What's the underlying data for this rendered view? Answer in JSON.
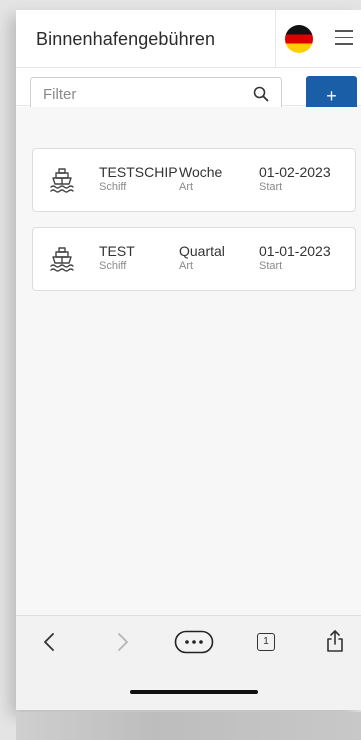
{
  "header": {
    "title": "Binnenhafengebühren"
  },
  "toolbar": {
    "filter_placeholder": "Filter",
    "add_label": "+"
  },
  "entries": [
    {
      "ship": "TESTSCHIP",
      "ship_label": "Schiff",
      "type": "Woche",
      "type_label": "Art",
      "start": "01-02-2023",
      "start_label": "Start"
    },
    {
      "ship": "TEST",
      "ship_label": "Schiff",
      "type": "Quartal",
      "type_label": "Art",
      "start": "01-01-2023",
      "start_label": "Start"
    }
  ],
  "browser": {
    "tabs_count": "1"
  },
  "colors": {
    "accent": "#1a5ea8",
    "flag": [
      "#111111",
      "#dd0000",
      "#ffce00"
    ]
  },
  "icons": [
    "flag-germany-icon",
    "menu-icon",
    "search-icon",
    "ship-icon",
    "back-icon",
    "forward-icon",
    "more-icon",
    "tabs-icon",
    "share-icon"
  ]
}
